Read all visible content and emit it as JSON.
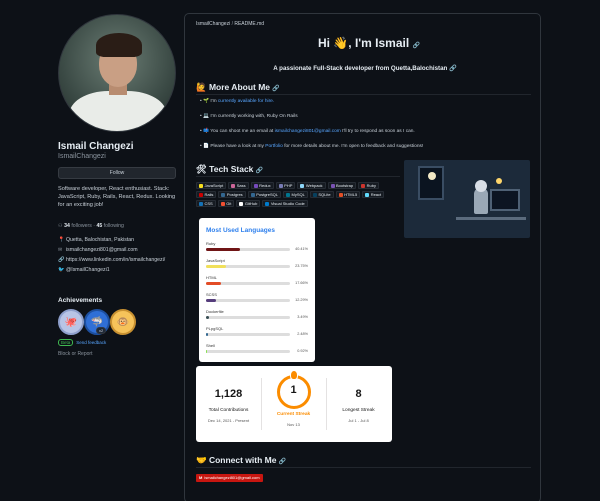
{
  "profile": {
    "name": "Ismail Changezi",
    "username": "IsmailChangezi",
    "follow_label": "Follow",
    "bio": "Software developer, React enthusiast. Stack: JavaScript, Ruby, Rails, React, Redux. Looking for an exciting job!",
    "followers": "34",
    "followers_label": "followers",
    "following": "45",
    "following_label": "following",
    "location": "Quetta, Balochistan, Pakistan",
    "email": "ismailchangezi801@gmail.com",
    "linkedin": "https://www.linkedin.com/in/ismailchangezi/",
    "twitter": "@IsmailChangezi1",
    "achievements_title": "Achievements",
    "badge_count": "x2",
    "beta_tag": "Beta",
    "feedback_label": "Send feedback",
    "block_label": "Block or Report"
  },
  "readme": {
    "crumb_user": "IsmailChangezi",
    "crumb_sep": "/",
    "crumb_file": "README.md",
    "greeting": "Hi 👋, I'm Ismail",
    "tagline": "A passionate Full-Stack developer from Quetta,Balochistan",
    "about_title": "🙋 More About Me",
    "about_items": [
      {
        "pre": "🌱 I'm ",
        "link": "currently available for hire.",
        "post": ""
      },
      {
        "pre": "💻 I'm currently working with, Ruby On Rails",
        "link": "",
        "post": ""
      },
      {
        "pre": "📫 You can shoot me an email at ",
        "link": "ismailchangezi801@gmail.com",
        "post": " I'll try to respond as soon as I can."
      },
      {
        "pre": "📄 Please have a look at my ",
        "link": "Portfolio",
        "post": " for more details about me. I'm open to feedback and suggestions!"
      }
    ],
    "tech_title": "🛠 Tech Stack",
    "tech_stack": [
      {
        "name": "JavaScript",
        "color": "#f7df1e"
      },
      {
        "name": "Sass",
        "color": "#cc6699"
      },
      {
        "name": "Redux",
        "color": "#764abc"
      },
      {
        "name": "PHP",
        "color": "#777bb4"
      },
      {
        "name": "Webpack",
        "color": "#8dd6f9"
      },
      {
        "name": "Bootstrap",
        "color": "#7952b3"
      },
      {
        "name": "Ruby",
        "color": "#cc342d"
      },
      {
        "name": "Rails",
        "color": "#cc0000"
      },
      {
        "name": "Postgres",
        "color": "#336791"
      },
      {
        "name": "PostgreSQL",
        "color": "#336791"
      },
      {
        "name": "MySQL",
        "color": "#00758f"
      },
      {
        "name": "SQLite",
        "color": "#07405e"
      },
      {
        "name": "HTML5",
        "color": "#e34f26"
      },
      {
        "name": "React",
        "color": "#61dafb"
      },
      {
        "name": "CSS",
        "color": "#1572b6"
      },
      {
        "name": "Git",
        "color": "#f05032"
      },
      {
        "name": "GitHub",
        "color": "#ffffff"
      },
      {
        "name": "Visual Studio Code",
        "color": "#007acc"
      }
    ],
    "connect_title": "🤝 Connect with Me",
    "gmail_label": "M",
    "gmail_text": "ismailchangezi801@gmail.com"
  },
  "languages_card": {
    "title": "Most Used Languages",
    "items": [
      {
        "name": "Ruby",
        "pct": "40.41%",
        "value": 40.41,
        "color": "#701516"
      },
      {
        "name": "JavaScript",
        "pct": "23.75%",
        "value": 23.75,
        "color": "#f1e05a"
      },
      {
        "name": "HTML",
        "pct": "17.66%",
        "value": 17.66,
        "color": "#e34c26"
      },
      {
        "name": "SCSS",
        "pct": "12.29%",
        "value": 12.29,
        "color": "#563d7c"
      },
      {
        "name": "Dockerfile",
        "pct": "3.49%",
        "value": 3.49,
        "color": "#384d54"
      },
      {
        "name": "PLpgSQL",
        "pct": "2.48%",
        "value": 2.48,
        "color": "#336790"
      },
      {
        "name": "Shell",
        "pct": "0.92%",
        "value": 0.92,
        "color": "#89e051"
      }
    ]
  },
  "streak_card": {
    "total_value": "1,128",
    "total_label": "Total Contributions",
    "total_range": "Dec 14, 2021 - Present",
    "current_value": "1",
    "current_label": "Current Streak",
    "current_date": "Nov 13",
    "longest_value": "8",
    "longest_label": "Longest Streak",
    "longest_range": "Jul 1 - Jul 8"
  },
  "icons": {
    "location": "📍",
    "email": "✉",
    "link": "🔗",
    "twitter": "🐦",
    "anchor": "🔗"
  }
}
